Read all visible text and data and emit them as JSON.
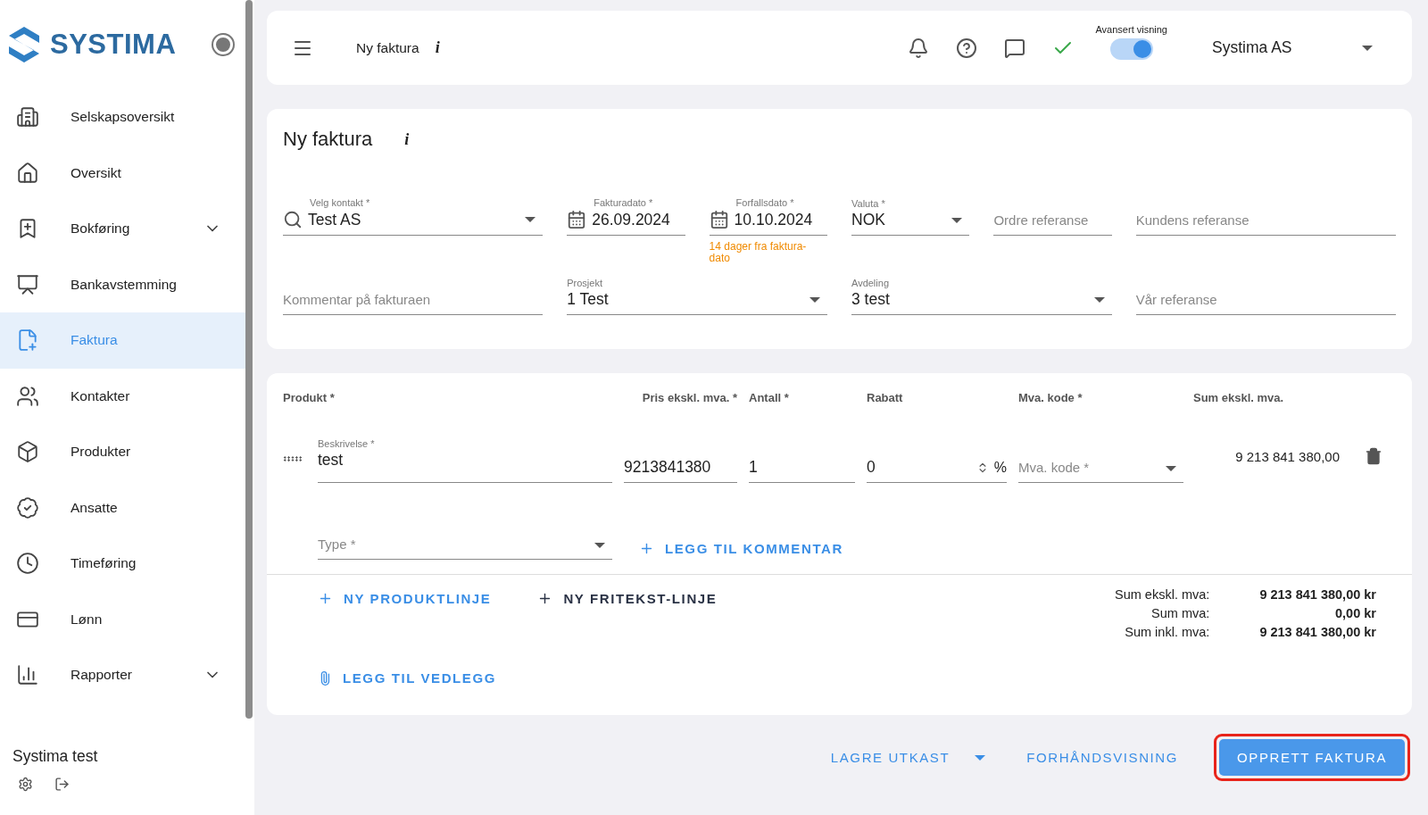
{
  "sidebar": {
    "logo": "SYSTIMA",
    "items": [
      {
        "label": "Selskapsoversikt",
        "selected": false,
        "has_submenu": false
      },
      {
        "label": "Oversikt",
        "selected": false,
        "has_submenu": false
      },
      {
        "label": "Bokføring",
        "selected": false,
        "has_submenu": true
      },
      {
        "label": "Bankavstemming",
        "selected": false,
        "has_submenu": false
      },
      {
        "label": "Faktura",
        "selected": true,
        "has_submenu": false
      },
      {
        "label": "Kontakter",
        "selected": false,
        "has_submenu": false
      },
      {
        "label": "Produkter",
        "selected": false,
        "has_submenu": false
      },
      {
        "label": "Ansatte",
        "selected": false,
        "has_submenu": false
      },
      {
        "label": "Timeføring",
        "selected": false,
        "has_submenu": false
      },
      {
        "label": "Lønn",
        "selected": false,
        "has_submenu": false
      },
      {
        "label": "Rapporter",
        "selected": false,
        "has_submenu": true
      }
    ],
    "account": "Systima test"
  },
  "topbar": {
    "title": "Ny faktura",
    "info_mark": "i",
    "advanced_view": {
      "label": "Avansert visning",
      "on": true
    },
    "company": "Systima AS"
  },
  "invoice_form": {
    "title": "Ny faktura",
    "info_mark": "i",
    "fields": [
      {
        "kind": "search-select",
        "label": "Velg kontakt *",
        "value": "Test AS"
      },
      {
        "kind": "date",
        "label": "Fakturadato *",
        "value": "26.09.2024"
      },
      {
        "kind": "date",
        "label": "Forfallsdato *",
        "value": "10.10.2024",
        "helper": "14 dager fra faktura-dato"
      },
      {
        "kind": "select",
        "label": "Valuta *",
        "value": "NOK"
      },
      {
        "kind": "text",
        "placeholder": "Ordre referanse"
      },
      {
        "kind": "text",
        "placeholder": "Kundens referanse"
      },
      {
        "kind": "text",
        "placeholder": "Kommentar på fakturaen"
      },
      {
        "kind": "select",
        "label": "Prosjekt",
        "value": "1 Test"
      },
      {
        "kind": "select",
        "label": "Avdeling",
        "value": "3 test"
      },
      {
        "kind": "text",
        "placeholder": "Vår referanse"
      }
    ]
  },
  "product_table": {
    "columns": [
      "Produkt *",
      "Pris ekskl. mva. *",
      "Antall *",
      "Rabatt",
      "Mva. kode *",
      "Sum ekskl. mva."
    ],
    "lines": [
      {
        "description_label": "Beskrivelse *",
        "description": "test",
        "price": "9213841380",
        "quantity": "1",
        "discount": "0",
        "discount_unit": "%",
        "vat_placeholder": "Mva. kode *",
        "sum": "9 213 841 380,00",
        "type_placeholder": "Type *",
        "comment_action": "LEGG TIL KOMMENTAR"
      }
    ],
    "actions": [
      {
        "kind": "product",
        "label": "NY PRODUKTLINJE"
      },
      {
        "kind": "freetext",
        "label": "NY FRITEKST-LINJE"
      }
    ],
    "totals": [
      {
        "label": "Sum ekskl. mva:",
        "value": "9 213 841 380,00 kr"
      },
      {
        "label": "Sum mva:",
        "value": "0,00 kr"
      },
      {
        "label": "Sum inkl. mva:",
        "value": "9 213 841 380,00 kr"
      }
    ],
    "attachment_action": "LEGG TIL VEDLEGG"
  },
  "footer_actions": [
    {
      "kind": "split",
      "label": "LAGRE UTKAST"
    },
    {
      "kind": "text",
      "label": "FORHÅNDSVISNING"
    },
    {
      "kind": "primary",
      "label": "OPPRETT FAKTURA",
      "highlighted": true
    }
  ]
}
